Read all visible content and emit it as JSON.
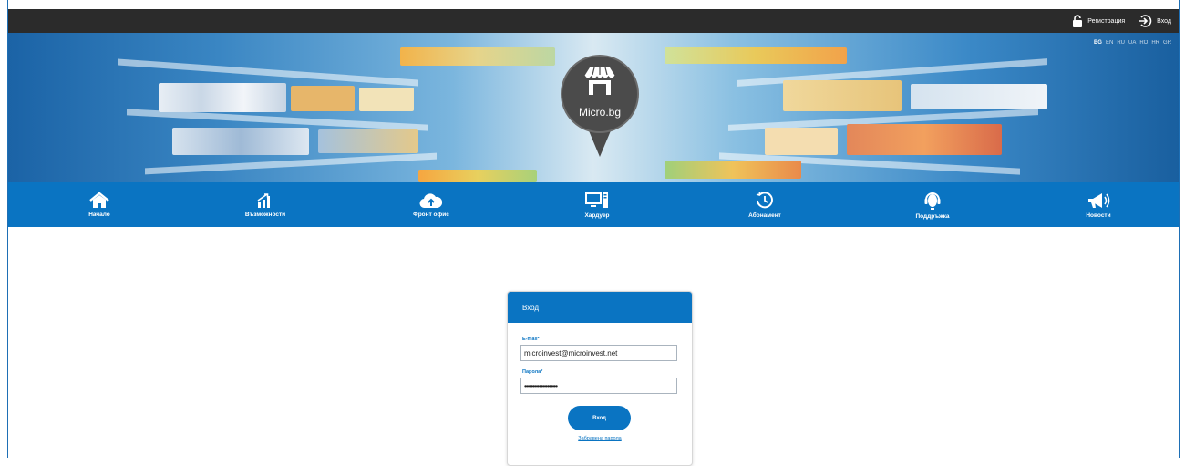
{
  "topbar": {
    "register_label": "Регистрация",
    "login_label": "Вход",
    "register_icon": "padlock-icon",
    "login_icon": "sign-in-icon"
  },
  "banner": {
    "logo_text": "Micro.bg",
    "logo_icon": "shop-awning-icon",
    "languages": [
      "BG",
      "EN",
      "RU",
      "UA",
      "RO",
      "HR",
      "GR"
    ],
    "active_language": "BG"
  },
  "nav": {
    "items": [
      {
        "label": "Начало",
        "icon": "home-icon"
      },
      {
        "label": "Възможности",
        "icon": "chart-icon"
      },
      {
        "label": "Фронт офис",
        "icon": "cloud-upload-icon"
      },
      {
        "label": "Хардуер",
        "icon": "computer-icon"
      },
      {
        "label": "Абонамент",
        "icon": "clock-icon"
      },
      {
        "label": "Поддръжка",
        "icon": "headset-icon"
      },
      {
        "label": "Новости",
        "icon": "megaphone-icon"
      }
    ]
  },
  "login": {
    "title": "Вход",
    "email_label": "E-mail*",
    "email_value": "microinvest@microinvest.net",
    "password_label": "Парола*",
    "password_value": "••••••••••••••••••••",
    "submit_label": "Вход",
    "forgot_label": "Забравена парола"
  },
  "colors": {
    "primary": "#0a74c2",
    "topbar": "#2b2b2b",
    "pin": "#4b4b4b"
  }
}
